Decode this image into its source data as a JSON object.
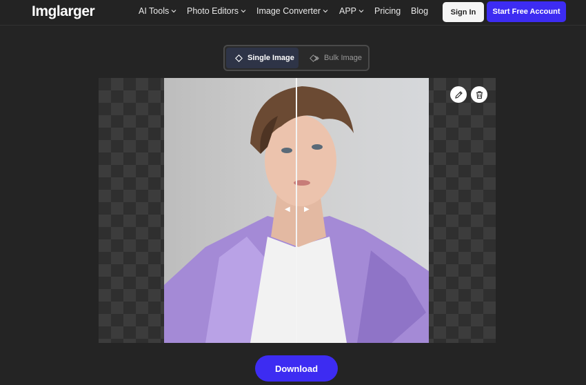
{
  "header": {
    "logo": "Imglarger",
    "nav": [
      {
        "label": "AI Tools",
        "has_dropdown": true
      },
      {
        "label": "Photo Editors",
        "has_dropdown": true
      },
      {
        "label": "Image Converter",
        "has_dropdown": true
      },
      {
        "label": "APP",
        "has_dropdown": true
      },
      {
        "label": "Pricing",
        "has_dropdown": false
      },
      {
        "label": "Blog",
        "has_dropdown": false
      }
    ],
    "sign_in": "Sign In",
    "start_free": "Start Free Account"
  },
  "mode_toggle": {
    "single": "Single Image",
    "bulk": "Bulk Image",
    "selected": "single"
  },
  "editor": {
    "edit_icon": "pencil-icon",
    "delete_icon": "trash-icon"
  },
  "download_label": "Download",
  "colors": {
    "accent": "#3d2cf2",
    "background": "#242424",
    "jacket": "#a48ad6",
    "selected_tab": "#2e3447"
  }
}
